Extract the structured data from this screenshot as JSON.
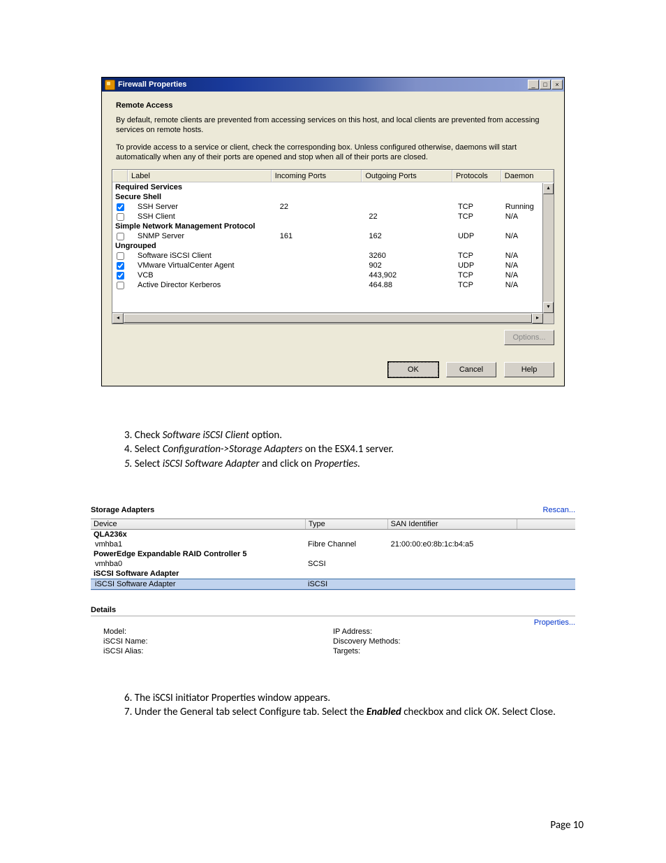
{
  "window": {
    "title": "Firewall Properties",
    "section_heading": "Remote Access",
    "para1": "By default, remote clients are prevented from accessing services on this host, and local clients are prevented from accessing services on remote hosts.",
    "para2": "To provide access to a service or client, check the corresponding box. Unless configured otherwise, daemons will start automatically when any of their ports are opened and stop when all of their ports are closed.",
    "columns": {
      "label": "Label",
      "incoming": "Incoming Ports",
      "outgoing": "Outgoing Ports",
      "protocols": "Protocols",
      "daemon": "Daemon"
    },
    "groups": [
      {
        "name": "Required Services",
        "rows": []
      },
      {
        "name": "Secure Shell",
        "rows": [
          {
            "checked": true,
            "label": "SSH Server",
            "in": "22",
            "out": "",
            "proto": "TCP",
            "daemon": "Running"
          },
          {
            "checked": false,
            "label": "SSH Client",
            "in": "",
            "out": "22",
            "proto": "TCP",
            "daemon": "N/A"
          }
        ]
      },
      {
        "name": "Simple Network Management Protocol",
        "rows": [
          {
            "checked": false,
            "label": "SNMP Server",
            "in": "161",
            "out": "162",
            "proto": "UDP",
            "daemon": "N/A"
          }
        ]
      },
      {
        "name": "Ungrouped",
        "rows": [
          {
            "checked": false,
            "label": "Software iSCSI Client",
            "in": "",
            "out": "3260",
            "proto": "TCP",
            "daemon": "N/A"
          },
          {
            "checked": true,
            "label": "VMware VirtualCenter Agent",
            "in": "",
            "out": "902",
            "proto": "UDP",
            "daemon": "N/A"
          },
          {
            "checked": true,
            "label": "VCB",
            "in": "",
            "out": "443,902",
            "proto": "TCP",
            "daemon": "N/A"
          },
          {
            "checked": false,
            "label": "Active Director Kerberos",
            "in": "",
            "out": "464.88",
            "proto": "TCP",
            "daemon": "N/A"
          }
        ]
      }
    ],
    "options_btn": "Options...",
    "ok": "OK",
    "cancel": "Cancel",
    "help": "Help"
  },
  "instr": {
    "l3a": "3. Check ",
    "l3b": "Software iSCSI Client",
    "l3c": " option.",
    "l4a": "4. Select ",
    "l4b": "Configuration->Storage Adapters",
    "l4c": " on the ESX4.1 server.",
    "l5a": "5.",
    "l5b": " Select ",
    "l5c": "iSCSI Software Adapter",
    "l5d": " and click on ",
    "l5e": "Properties."
  },
  "storage": {
    "title": "Storage Adapters",
    "rescan": "Rescan...",
    "head": {
      "device": "Device",
      "type": "Type",
      "san": "SAN Identifier"
    },
    "groups": [
      {
        "name": "QLA236x",
        "rows": [
          {
            "device": "vmhba1",
            "type": "Fibre Channel",
            "san": "21:00:00:e0:8b:1c:b4:a5"
          }
        ]
      },
      {
        "name": "PowerEdge Expandable RAID Controller 5",
        "rows": [
          {
            "device": "vmhba0",
            "type": "SCSI",
            "san": ""
          }
        ]
      },
      {
        "name": "iSCSI Software Adapter",
        "rows": [
          {
            "device": "iSCSI Software Adapter",
            "type": "iSCSI",
            "san": "",
            "selected": true
          }
        ]
      }
    ],
    "details": "Details",
    "properties": "Properties...",
    "labels": {
      "model": "Model:",
      "iscsi_name": "iSCSI Name:",
      "iscsi_alias": "iSCSI Alias:",
      "ip": "IP Address:",
      "discovery": "Discovery Methods:",
      "targets": "Targets:"
    }
  },
  "instr2": {
    "l6": "6. The iSCSI initiator Properties window appears.",
    "l7a": "7. Under the General tab select Configure tab. Select the ",
    "l7b": "Enabled",
    "l7c": " checkbox and click ",
    "l7d": "OK",
    "l7e": ". Select Close."
  },
  "footer": "Page 10"
}
